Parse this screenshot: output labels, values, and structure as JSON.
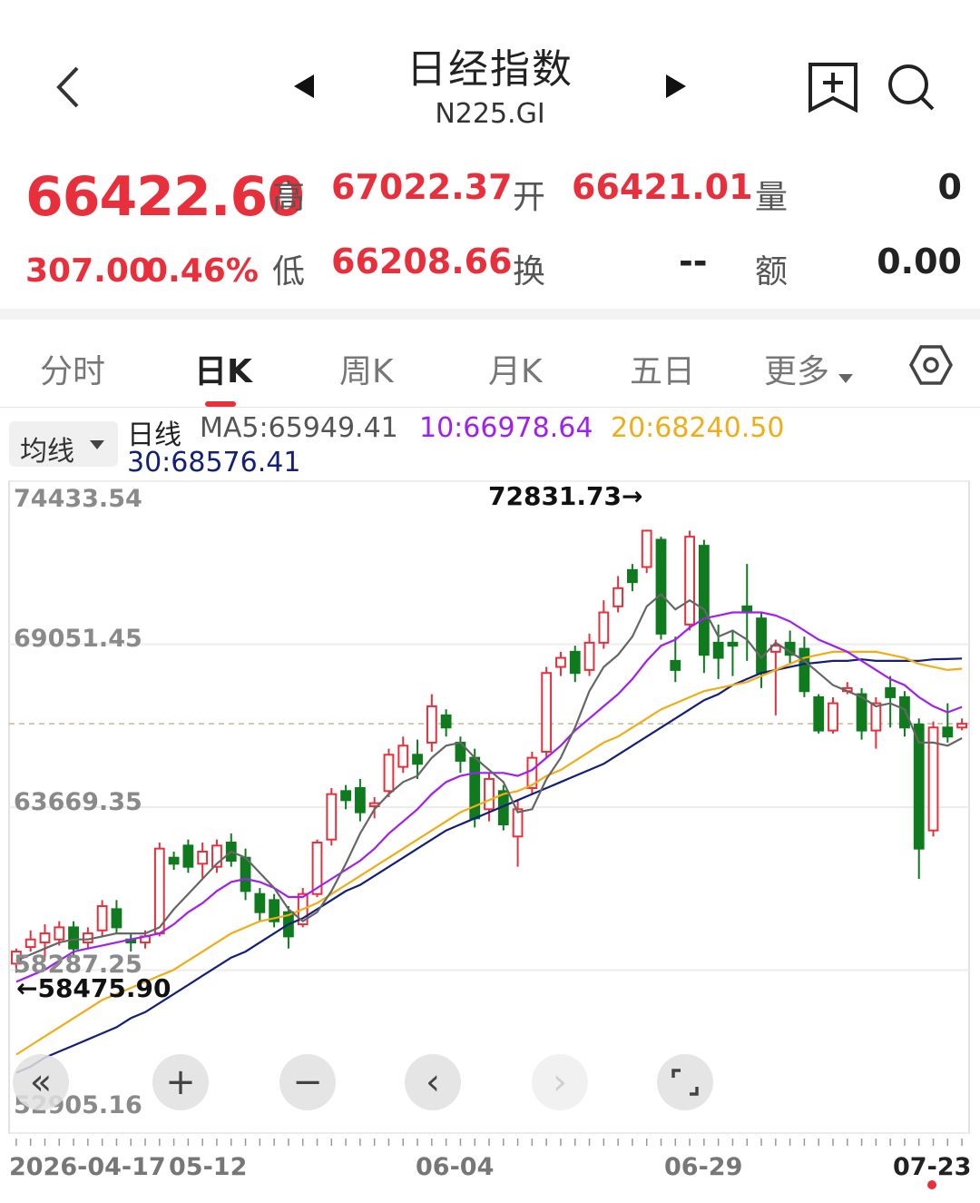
{
  "header": {
    "title": "日经指数",
    "code": "N225.GI"
  },
  "quote": {
    "price": "66422.60",
    "change": "307.00",
    "change_pct": "0.46%",
    "high_label": "高",
    "high": "67022.37",
    "open_label": "开",
    "open": "66421.01",
    "volume_label": "量",
    "volume": "0",
    "low_label": "低",
    "low": "66208.66",
    "turnover_label": "换",
    "turnover": "--",
    "amount_label": "额",
    "amount": "0.00"
  },
  "tabs": [
    "分时",
    "日K",
    "周K",
    "月K",
    "五日",
    "更多"
  ],
  "active_tab": "日K",
  "ma_bar": {
    "button": "均线",
    "period": "日线",
    "ma5": "MA5:65949.41",
    "ma10": "10:66978.64",
    "ma20": "20:68240.50",
    "ma30": "30:68576.41"
  },
  "colors": {
    "up": "#e8303c",
    "down": "#0f7a1e",
    "ma5": "#666666",
    "ma10": "#a020f0",
    "ma20": "#f0ad16",
    "ma30": "#141f7a"
  },
  "chart_data": {
    "type": "candlestick",
    "title": "",
    "ylim": [
      52905.16,
      74433.54
    ],
    "y_ticks": [
      "74433.54",
      "69051.45",
      "63669.35",
      "58287.25",
      "52905.16"
    ],
    "x_ticks": [
      "2026-04-17",
      "05-12",
      "06-04",
      "06-29",
      "07-23"
    ],
    "max_label": "72831.73→",
    "min_label": "←58475.90",
    "last_close": 66422.6,
    "candles": [
      [
        58500,
        58900,
        59000,
        58200
      ],
      [
        59050,
        59300,
        59600,
        58900
      ],
      [
        59200,
        59500,
        59800,
        58700
      ],
      [
        59300,
        59700,
        59900,
        59100
      ],
      [
        59700,
        59000,
        59900,
        58700
      ],
      [
        59200,
        59500,
        59700,
        59000
      ],
      [
        59600,
        60400,
        60600,
        59400
      ],
      [
        60300,
        59700,
        60600,
        59500
      ],
      [
        59300,
        59200,
        59500,
        58900
      ],
      [
        59200,
        59400,
        59600,
        59000
      ],
      [
        59500,
        62300,
        62500,
        59400
      ],
      [
        62000,
        61800,
        62200,
        61600
      ],
      [
        62400,
        61700,
        62600,
        61500
      ],
      [
        61800,
        62200,
        62500,
        61300
      ],
      [
        61700,
        62400,
        62600,
        61500
      ],
      [
        62500,
        61900,
        62800,
        61700
      ],
      [
        62000,
        60900,
        62300,
        60600
      ],
      [
        60800,
        60200,
        61000,
        59900
      ],
      [
        60600,
        59900,
        60800,
        59700
      ],
      [
        60200,
        59400,
        60400,
        59000
      ],
      [
        59800,
        60800,
        61000,
        59700
      ],
      [
        60800,
        62500,
        62600,
        60700
      ],
      [
        62600,
        64100,
        64300,
        62400
      ],
      [
        64200,
        63900,
        64400,
        63600
      ],
      [
        64300,
        63500,
        64600,
        63200
      ],
      [
        63700,
        63800,
        64000,
        63300
      ],
      [
        64200,
        65400,
        65600,
        64000
      ],
      [
        65000,
        65700,
        66000,
        64800
      ],
      [
        65400,
        65100,
        65900,
        64600
      ],
      [
        65800,
        67000,
        67400,
        65500
      ],
      [
        66700,
        66300,
        66900,
        66000
      ],
      [
        65800,
        65200,
        66000,
        64800
      ],
      [
        65300,
        63300,
        65600,
        63000
      ],
      [
        63600,
        64600,
        64800,
        63200
      ],
      [
        64200,
        63100,
        64400,
        62900
      ],
      [
        62700,
        63600,
        63900,
        61700
      ],
      [
        64300,
        65300,
        65500,
        64100
      ],
      [
        65500,
        68100,
        68300,
        65300
      ],
      [
        68300,
        68600,
        68800,
        68000
      ],
      [
        68800,
        68100,
        69000,
        67800
      ],
      [
        68200,
        69100,
        69400,
        68000
      ],
      [
        69100,
        70100,
        70500,
        68900
      ],
      [
        70300,
        70900,
        71300,
        70100
      ],
      [
        71500,
        71100,
        71700,
        70800
      ],
      [
        71600,
        72800,
        72831.73,
        71400
      ],
      [
        72500,
        69400,
        72600,
        69200
      ],
      [
        68500,
        68200,
        69300,
        67800
      ],
      [
        69700,
        72600,
        72800,
        69500
      ],
      [
        72300,
        68700,
        72500,
        68100
      ],
      [
        69100,
        68600,
        69700,
        67900
      ],
      [
        69100,
        69000,
        69500,
        68000
      ],
      [
        70300,
        70100,
        71700,
        68500
      ],
      [
        69900,
        68100,
        70100,
        67600
      ],
      [
        68800,
        69000,
        69200,
        66700
      ],
      [
        69100,
        68700,
        69500,
        68400
      ],
      [
        68900,
        67500,
        69300,
        67300
      ],
      [
        67300,
        66200,
        67400,
        66100
      ],
      [
        66200,
        67100,
        67300,
        66100
      ],
      [
        67500,
        67600,
        67800,
        67400
      ],
      [
        67400,
        66200,
        67600,
        65900
      ],
      [
        66200,
        67100,
        67300,
        65600
      ],
      [
        67600,
        67300,
        68000,
        66300
      ],
      [
        67300,
        66300,
        67500,
        66000
      ],
      [
        66400,
        62300,
        66600,
        61300
      ],
      [
        62900,
        66300,
        66500,
        62700
      ],
      [
        66300,
        66000,
        67100,
        65800
      ],
      [
        66300,
        66422.6,
        66600,
        66208.66
      ]
    ],
    "ma5": [
      58600,
      58800,
      59000,
      59200,
      59300,
      59300,
      59400,
      59500,
      59500,
      59500,
      59700,
      60300,
      60800,
      61300,
      61800,
      62200,
      62000,
      61500,
      61000,
      60300,
      59900,
      60200,
      60900,
      61800,
      62800,
      63600,
      64100,
      64500,
      64700,
      65300,
      65700,
      65800,
      65300,
      64900,
      64500,
      63500,
      63600,
      64600,
      65300,
      66300,
      67500,
      68300,
      68700,
      69300,
      70300,
      70700,
      70200,
      70500,
      70200,
      69300,
      69500,
      69200,
      68600,
      69100,
      68800,
      68500,
      68100,
      67700,
      67500,
      67300,
      67000,
      67100,
      66900,
      65800,
      65800,
      65700,
      65949.41
    ],
    "ma10": [
      57900,
      58100,
      58300,
      58600,
      58900,
      59000,
      59100,
      59200,
      59300,
      59400,
      59500,
      59800,
      60200,
      60500,
      60900,
      61200,
      61300,
      61200,
      61000,
      60700,
      60700,
      61000,
      61300,
      61600,
      61900,
      62300,
      62800,
      63200,
      63600,
      64100,
      64500,
      64700,
      64800,
      64800,
      64800,
      64700,
      64900,
      65300,
      65700,
      66200,
      66600,
      67000,
      67400,
      67900,
      68500,
      69000,
      69200,
      69600,
      69900,
      70000,
      70100,
      70100,
      70100,
      70000,
      69800,
      69500,
      69200,
      69000,
      68800,
      68500,
      68200,
      67900,
      67700,
      67300,
      67000,
      66800,
      66978.64
    ],
    "ma20": [
      55500,
      55800,
      56100,
      56400,
      56700,
      57000,
      57300,
      57500,
      57700,
      57900,
      58100,
      58300,
      58600,
      58900,
      59200,
      59500,
      59700,
      59900,
      60000,
      60100,
      60300,
      60500,
      60800,
      61100,
      61400,
      61700,
      62000,
      62300,
      62600,
      62900,
      63200,
      63500,
      63700,
      63900,
      64100,
      64200,
      64400,
      64700,
      64900,
      65200,
      65500,
      65800,
      66000,
      66300,
      66600,
      66900,
      67100,
      67300,
      67500,
      67600,
      67700,
      67800,
      68000,
      68200,
      68400,
      68600,
      68700,
      68800,
      68800,
      68800,
      68800,
      68700,
      68600,
      68400,
      68300,
      68200,
      68240.5
    ],
    "ma30": [
      54900,
      55100,
      55400,
      55600,
      55800,
      56000,
      56200,
      56400,
      56700,
      56900,
      57200,
      57500,
      57800,
      58100,
      58400,
      58700,
      58900,
      59200,
      59500,
      59800,
      60000,
      60300,
      60600,
      60900,
      61100,
      61400,
      61700,
      62000,
      62300,
      62600,
      62900,
      63100,
      63300,
      63500,
      63700,
      63900,
      64100,
      64300,
      64500,
      64700,
      64900,
      65100,
      65400,
      65700,
      66000,
      66300,
      66600,
      66900,
      67200,
      67400,
      67700,
      67900,
      68100,
      68200,
      68300,
      68400,
      68450,
      68500,
      68500,
      68550,
      68500,
      68500,
      68500,
      68500,
      68550,
      68560,
      68576.41
    ]
  }
}
